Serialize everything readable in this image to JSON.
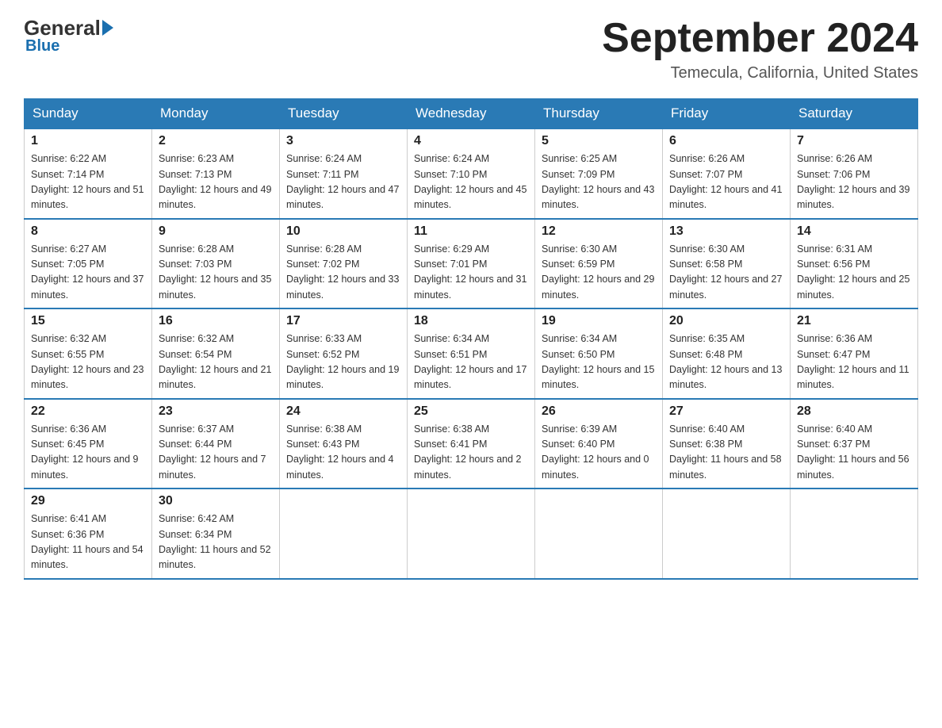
{
  "header": {
    "logo_general": "General",
    "logo_blue": "Blue",
    "month_title": "September 2024",
    "location": "Temecula, California, United States"
  },
  "days_of_week": [
    "Sunday",
    "Monday",
    "Tuesday",
    "Wednesday",
    "Thursday",
    "Friday",
    "Saturday"
  ],
  "weeks": [
    [
      {
        "num": "1",
        "sunrise": "6:22 AM",
        "sunset": "7:14 PM",
        "daylight": "12 hours and 51 minutes."
      },
      {
        "num": "2",
        "sunrise": "6:23 AM",
        "sunset": "7:13 PM",
        "daylight": "12 hours and 49 minutes."
      },
      {
        "num": "3",
        "sunrise": "6:24 AM",
        "sunset": "7:11 PM",
        "daylight": "12 hours and 47 minutes."
      },
      {
        "num": "4",
        "sunrise": "6:24 AM",
        "sunset": "7:10 PM",
        "daylight": "12 hours and 45 minutes."
      },
      {
        "num": "5",
        "sunrise": "6:25 AM",
        "sunset": "7:09 PM",
        "daylight": "12 hours and 43 minutes."
      },
      {
        "num": "6",
        "sunrise": "6:26 AM",
        "sunset": "7:07 PM",
        "daylight": "12 hours and 41 minutes."
      },
      {
        "num": "7",
        "sunrise": "6:26 AM",
        "sunset": "7:06 PM",
        "daylight": "12 hours and 39 minutes."
      }
    ],
    [
      {
        "num": "8",
        "sunrise": "6:27 AM",
        "sunset": "7:05 PM",
        "daylight": "12 hours and 37 minutes."
      },
      {
        "num": "9",
        "sunrise": "6:28 AM",
        "sunset": "7:03 PM",
        "daylight": "12 hours and 35 minutes."
      },
      {
        "num": "10",
        "sunrise": "6:28 AM",
        "sunset": "7:02 PM",
        "daylight": "12 hours and 33 minutes."
      },
      {
        "num": "11",
        "sunrise": "6:29 AM",
        "sunset": "7:01 PM",
        "daylight": "12 hours and 31 minutes."
      },
      {
        "num": "12",
        "sunrise": "6:30 AM",
        "sunset": "6:59 PM",
        "daylight": "12 hours and 29 minutes."
      },
      {
        "num": "13",
        "sunrise": "6:30 AM",
        "sunset": "6:58 PM",
        "daylight": "12 hours and 27 minutes."
      },
      {
        "num": "14",
        "sunrise": "6:31 AM",
        "sunset": "6:56 PM",
        "daylight": "12 hours and 25 minutes."
      }
    ],
    [
      {
        "num": "15",
        "sunrise": "6:32 AM",
        "sunset": "6:55 PM",
        "daylight": "12 hours and 23 minutes."
      },
      {
        "num": "16",
        "sunrise": "6:32 AM",
        "sunset": "6:54 PM",
        "daylight": "12 hours and 21 minutes."
      },
      {
        "num": "17",
        "sunrise": "6:33 AM",
        "sunset": "6:52 PM",
        "daylight": "12 hours and 19 minutes."
      },
      {
        "num": "18",
        "sunrise": "6:34 AM",
        "sunset": "6:51 PM",
        "daylight": "12 hours and 17 minutes."
      },
      {
        "num": "19",
        "sunrise": "6:34 AM",
        "sunset": "6:50 PM",
        "daylight": "12 hours and 15 minutes."
      },
      {
        "num": "20",
        "sunrise": "6:35 AM",
        "sunset": "6:48 PM",
        "daylight": "12 hours and 13 minutes."
      },
      {
        "num": "21",
        "sunrise": "6:36 AM",
        "sunset": "6:47 PM",
        "daylight": "12 hours and 11 minutes."
      }
    ],
    [
      {
        "num": "22",
        "sunrise": "6:36 AM",
        "sunset": "6:45 PM",
        "daylight": "12 hours and 9 minutes."
      },
      {
        "num": "23",
        "sunrise": "6:37 AM",
        "sunset": "6:44 PM",
        "daylight": "12 hours and 7 minutes."
      },
      {
        "num": "24",
        "sunrise": "6:38 AM",
        "sunset": "6:43 PM",
        "daylight": "12 hours and 4 minutes."
      },
      {
        "num": "25",
        "sunrise": "6:38 AM",
        "sunset": "6:41 PM",
        "daylight": "12 hours and 2 minutes."
      },
      {
        "num": "26",
        "sunrise": "6:39 AM",
        "sunset": "6:40 PM",
        "daylight": "12 hours and 0 minutes."
      },
      {
        "num": "27",
        "sunrise": "6:40 AM",
        "sunset": "6:38 PM",
        "daylight": "11 hours and 58 minutes."
      },
      {
        "num": "28",
        "sunrise": "6:40 AM",
        "sunset": "6:37 PM",
        "daylight": "11 hours and 56 minutes."
      }
    ],
    [
      {
        "num": "29",
        "sunrise": "6:41 AM",
        "sunset": "6:36 PM",
        "daylight": "11 hours and 54 minutes."
      },
      {
        "num": "30",
        "sunrise": "6:42 AM",
        "sunset": "6:34 PM",
        "daylight": "11 hours and 52 minutes."
      },
      null,
      null,
      null,
      null,
      null
    ]
  ]
}
